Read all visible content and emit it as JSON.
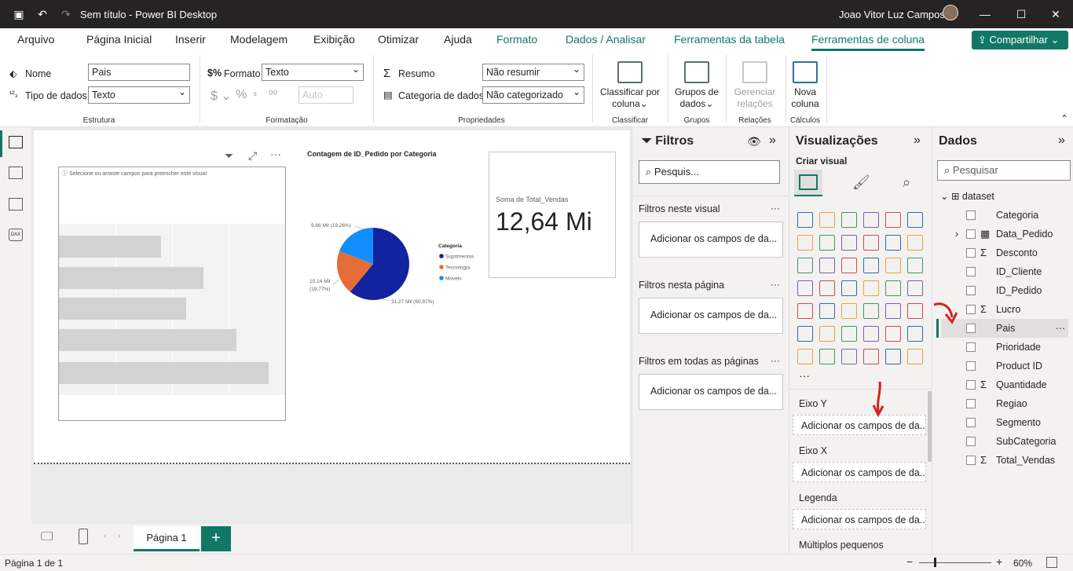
{
  "titlebar": {
    "title": "Sem título - Power BI Desktop",
    "user": "Joao Vitor Luz Campos"
  },
  "menu": {
    "tabs": [
      "Arquivo",
      "Página Inicial",
      "Inserir",
      "Modelagem",
      "Exibição",
      "Otimizar",
      "Ajuda",
      "Formato",
      "Dados / Analisar",
      "Ferramentas da tabela",
      "Ferramentas de coluna"
    ],
    "active_tab": "Ferramentas de coluna",
    "share_label": "Compartilhar"
  },
  "ribbon": {
    "estrutura": {
      "nome_label": "Nome",
      "nome_value": "Pais",
      "tipo_label": "Tipo de dados",
      "tipo_value": "Texto",
      "group_label": "Estrutura"
    },
    "formatacao": {
      "formato_label": "Formato",
      "formato_value": "Texto",
      "auto_value": "Auto",
      "group_label": "Formatação"
    },
    "propriedades": {
      "resumo_label": "Resumo",
      "resumo_value": "Não resumir",
      "categoria_label": "Categoria de dados",
      "categoria_value": "Não categorizado",
      "group_label": "Propriedades"
    },
    "classificar": {
      "btn_line1": "Classificar por",
      "btn_line2": "coluna",
      "group_label": "Classificar"
    },
    "grupos": {
      "btn_line1": "Grupos de",
      "btn_line2": "dados",
      "group_label": "Grupos"
    },
    "relacoes": {
      "btn_line1": "Gerenciar",
      "btn_line2": "relações",
      "group_label": "Relações"
    },
    "calculos": {
      "btn_line1": "Nova",
      "btn_line2": "coluna",
      "group_label": "Cálculos"
    }
  },
  "canvas": {
    "empty_visual_hint": "Selecione ou arraste campos para preencher este visual",
    "pie_title": "Contagem de ID_Pedido por Categoria",
    "card_label": "Soma de Total_Vendas",
    "card_value": "12,64 Mi"
  },
  "chart_data": {
    "type": "pie",
    "title": "Contagem de ID_Pedido por Categoria",
    "legend_title": "Categoria",
    "legend_position": "right",
    "slices": [
      {
        "name": "Suprimentos",
        "value": 31.27,
        "label": "31,27 Mil (60,97%)",
        "color": "#12239e"
      },
      {
        "name": "Tecnologia",
        "value": 10.14,
        "label_line1": "10,14 Mil",
        "label_line2": "(19,77%)",
        "color": "#e66c37"
      },
      {
        "name": "Moveis",
        "value": 9.88,
        "label": "9,88 Mil (19,26%)",
        "color": "#118dff"
      }
    ]
  },
  "pages": {
    "tab_label": "Página 1",
    "add_label": "+",
    "status": "Página 1 de 1",
    "zoom": "60%"
  },
  "filters": {
    "title": "Filtros",
    "search_placeholder": "Pesquis...",
    "sections": [
      {
        "label": "Filtros neste visual",
        "box": "Adicionar os campos de da..."
      },
      {
        "label": "Filtros nesta página",
        "box": "Adicionar os campos de da..."
      },
      {
        "label": "Filtros em todas as páginas",
        "box": "Adicionar os campos de da..."
      }
    ]
  },
  "viz": {
    "title": "Visualizações",
    "subtitle": "Criar visual",
    "wells": [
      {
        "label": "Eixo Y",
        "box": "Adicionar os campos de da..."
      },
      {
        "label": "Eixo X",
        "box": "Adicionar os campos de da..."
      },
      {
        "label": "Legenda",
        "box": "Adicionar os campos de da..."
      },
      {
        "label": "Múltiplos pequenos"
      }
    ],
    "more": "···"
  },
  "data": {
    "title": "Dados",
    "search_placeholder": "Pesquisar",
    "table": "dataset",
    "fields": [
      {
        "name": "Categoria",
        "sigma": ""
      },
      {
        "name": "Data_Pedido",
        "sigma": ""
      },
      {
        "name": "Desconto",
        "sigma": "Σ"
      },
      {
        "name": "ID_Cliente",
        "sigma": ""
      },
      {
        "name": "ID_Pedido",
        "sigma": ""
      },
      {
        "name": "Lucro",
        "sigma": "Σ"
      },
      {
        "name": "Pais",
        "sigma": ""
      },
      {
        "name": "Prioridade",
        "sigma": ""
      },
      {
        "name": "Product ID",
        "sigma": ""
      },
      {
        "name": "Quantidade",
        "sigma": "Σ"
      },
      {
        "name": "Regiao",
        "sigma": ""
      },
      {
        "name": "Segmento",
        "sigma": ""
      },
      {
        "name": "SubCategoria",
        "sigma": ""
      },
      {
        "name": "Total_Vendas",
        "sigma": "Σ"
      }
    ],
    "selected_field": "Pais"
  },
  "colors": {
    "accent": "#117865",
    "titlebar": "#252423"
  }
}
